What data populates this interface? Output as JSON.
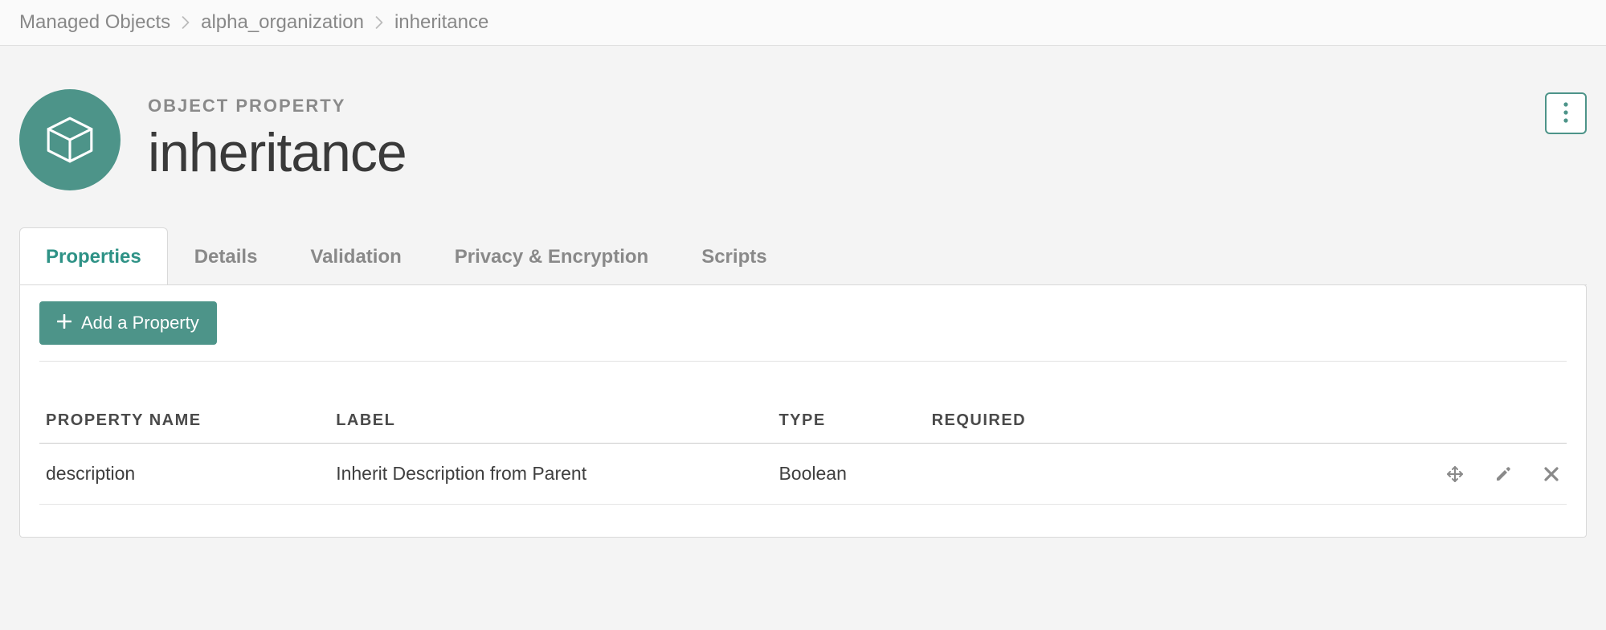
{
  "breadcrumb": {
    "items": [
      {
        "label": "Managed Objects"
      },
      {
        "label": "alpha_organization"
      },
      {
        "label": "inheritance"
      }
    ]
  },
  "header": {
    "eyebrow": "OBJECT PROPERTY",
    "title": "inheritance"
  },
  "tabs": [
    {
      "label": "Properties",
      "active": true
    },
    {
      "label": "Details"
    },
    {
      "label": "Validation"
    },
    {
      "label": "Privacy & Encryption"
    },
    {
      "label": "Scripts"
    }
  ],
  "panel": {
    "add_button_label": "Add a Property",
    "table": {
      "headers": {
        "name": "PROPERTY NAME",
        "label": "LABEL",
        "type": "TYPE",
        "required": "REQUIRED"
      },
      "rows": [
        {
          "name": "description",
          "label": "Inherit Description from Parent",
          "type": "Boolean",
          "required": ""
        }
      ]
    }
  },
  "colors": {
    "accent": "#4d9489",
    "muted": "#888888"
  }
}
